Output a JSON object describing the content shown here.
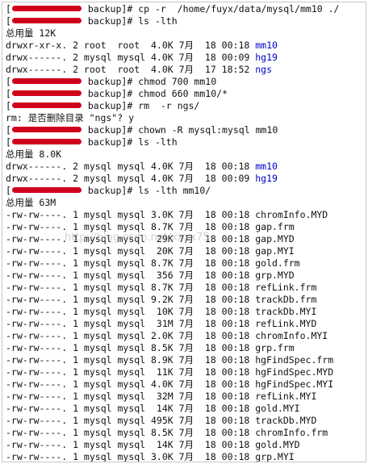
{
  "colors": {
    "directory_name": "#0000cc",
    "redaction": "#d0021b",
    "text": "#111111",
    "background": "#ffffff"
  },
  "watermark": "http://blog.csdn.net/xxxx75",
  "lines": [
    {
      "type": "prompt",
      "cwd": "backup",
      "cmd": "cp -r  /home/fuyx/data/mysql/mm10 ./"
    },
    {
      "type": "prompt",
      "cwd": "backup",
      "cmd": "ls -lth"
    },
    {
      "type": "text",
      "text": "总用量 12K"
    },
    {
      "type": "entry",
      "perm": "drwxr-xr-x.",
      "links": "2",
      "user": "root ",
      "group": "root ",
      "size": "4.0K",
      "month": "7月",
      "day": "18",
      "time": "00:18",
      "name": "mm10",
      "dir": true
    },
    {
      "type": "entry",
      "perm": "drwx------.",
      "links": "2",
      "user": "mysql",
      "group": "mysql",
      "size": "4.0K",
      "month": "7月",
      "day": "18",
      "time": "00:09",
      "name": "hg19",
      "dir": true
    },
    {
      "type": "entry",
      "perm": "drwx------.",
      "links": "2",
      "user": "root ",
      "group": "root ",
      "size": "4.0K",
      "month": "7月",
      "day": "17",
      "time": "18:52",
      "name": "ngs",
      "dir": true
    },
    {
      "type": "prompt",
      "cwd": "backup",
      "cmd": "chmod 700 mm10"
    },
    {
      "type": "prompt",
      "cwd": "backup",
      "cmd": "chmod 660 mm10/*"
    },
    {
      "type": "prompt",
      "cwd": "backup",
      "cmd": "rm  -r ngs/"
    },
    {
      "type": "text",
      "text": "rm: 是否删除目录 \"ngs\"? y"
    },
    {
      "type": "prompt",
      "cwd": "backup",
      "cmd": "chown -R mysql:mysql mm10"
    },
    {
      "type": "prompt",
      "cwd": "backup",
      "cmd": "ls -lth"
    },
    {
      "type": "text",
      "text": "总用量 8.0K"
    },
    {
      "type": "entry",
      "perm": "drwx------.",
      "links": "2",
      "user": "mysql",
      "group": "mysql",
      "size": "4.0K",
      "month": "7月",
      "day": "18",
      "time": "00:18",
      "name": "mm10",
      "dir": true
    },
    {
      "type": "entry",
      "perm": "drwx------.",
      "links": "2",
      "user": "mysql",
      "group": "mysql",
      "size": "4.0K",
      "month": "7月",
      "day": "18",
      "time": "00:09",
      "name": "hg19",
      "dir": true
    },
    {
      "type": "prompt",
      "cwd": "backup",
      "cmd": "ls -lth mm10/"
    },
    {
      "type": "text",
      "text": "总用量 63M"
    },
    {
      "type": "entry",
      "perm": "-rw-rw----.",
      "links": "1",
      "user": "mysql",
      "group": "mysql",
      "size": "3.0K",
      "month": "7月",
      "day": "18",
      "time": "00:18",
      "name": "chromInfo.MYD"
    },
    {
      "type": "entry",
      "perm": "-rw-rw----.",
      "links": "1",
      "user": "mysql",
      "group": "mysql",
      "size": "8.7K",
      "month": "7月",
      "day": "18",
      "time": "00:18",
      "name": "gap.frm"
    },
    {
      "type": "entry",
      "perm": "-rw-rw----.",
      "links": "1",
      "user": "mysql",
      "group": "mysql",
      "size": "29K",
      "month": "7月",
      "day": "18",
      "time": "00:18",
      "name": "gap.MYD"
    },
    {
      "type": "entry",
      "perm": "-rw-rw----.",
      "links": "1",
      "user": "mysql",
      "group": "mysql",
      "size": "20K",
      "month": "7月",
      "day": "18",
      "time": "00:18",
      "name": "gap.MYI"
    },
    {
      "type": "entry",
      "perm": "-rw-rw----.",
      "links": "1",
      "user": "mysql",
      "group": "mysql",
      "size": "8.7K",
      "month": "7月",
      "day": "18",
      "time": "00:18",
      "name": "gold.frm"
    },
    {
      "type": "entry",
      "perm": "-rw-rw----.",
      "links": "1",
      "user": "mysql",
      "group": "mysql",
      "size": "356",
      "month": "7月",
      "day": "18",
      "time": "00:18",
      "name": "grp.MYD"
    },
    {
      "type": "entry",
      "perm": "-rw-rw----.",
      "links": "1",
      "user": "mysql",
      "group": "mysql",
      "size": "8.7K",
      "month": "7月",
      "day": "18",
      "time": "00:18",
      "name": "refLink.frm"
    },
    {
      "type": "entry",
      "perm": "-rw-rw----.",
      "links": "1",
      "user": "mysql",
      "group": "mysql",
      "size": "9.2K",
      "month": "7月",
      "day": "18",
      "time": "00:18",
      "name": "trackDb.frm"
    },
    {
      "type": "entry",
      "perm": "-rw-rw----.",
      "links": "1",
      "user": "mysql",
      "group": "mysql",
      "size": "10K",
      "month": "7月",
      "day": "18",
      "time": "00:18",
      "name": "trackDb.MYI"
    },
    {
      "type": "entry",
      "perm": "-rw-rw----.",
      "links": "1",
      "user": "mysql",
      "group": "mysql",
      "size": "31M",
      "month": "7月",
      "day": "18",
      "time": "00:18",
      "name": "refLink.MYD"
    },
    {
      "type": "entry",
      "perm": "-rw-rw----.",
      "links": "1",
      "user": "mysql",
      "group": "mysql",
      "size": "2.0K",
      "month": "7月",
      "day": "18",
      "time": "00:18",
      "name": "chromInfo.MYI"
    },
    {
      "type": "entry",
      "perm": "-rw-rw----.",
      "links": "1",
      "user": "mysql",
      "group": "mysql",
      "size": "8.5K",
      "month": "7月",
      "day": "18",
      "time": "00:18",
      "name": "grp.frm"
    },
    {
      "type": "entry",
      "perm": "-rw-rw----.",
      "links": "1",
      "user": "mysql",
      "group": "mysql",
      "size": "8.9K",
      "month": "7月",
      "day": "18",
      "time": "00:18",
      "name": "hgFindSpec.frm"
    },
    {
      "type": "entry",
      "perm": "-rw-rw----.",
      "links": "1",
      "user": "mysql",
      "group": "mysql",
      "size": "11K",
      "month": "7月",
      "day": "18",
      "time": "00:18",
      "name": "hgFindSpec.MYD"
    },
    {
      "type": "entry",
      "perm": "-rw-rw----.",
      "links": "1",
      "user": "mysql",
      "group": "mysql",
      "size": "4.0K",
      "month": "7月",
      "day": "18",
      "time": "00:18",
      "name": "hgFindSpec.MYI"
    },
    {
      "type": "entry",
      "perm": "-rw-rw----.",
      "links": "1",
      "user": "mysql",
      "group": "mysql",
      "size": "32M",
      "month": "7月",
      "day": "18",
      "time": "00:18",
      "name": "refLink.MYI"
    },
    {
      "type": "entry",
      "perm": "-rw-rw----.",
      "links": "1",
      "user": "mysql",
      "group": "mysql",
      "size": "14K",
      "month": "7月",
      "day": "18",
      "time": "00:18",
      "name": "gold.MYI"
    },
    {
      "type": "entry",
      "perm": "-rw-rw----.",
      "links": "1",
      "user": "mysql",
      "group": "mysql",
      "size": "495K",
      "month": "7月",
      "day": "18",
      "time": "00:18",
      "name": "trackDb.MYD"
    },
    {
      "type": "entry",
      "perm": "-rw-rw----.",
      "links": "1",
      "user": "mysql",
      "group": "mysql",
      "size": "8.5K",
      "month": "7月",
      "day": "18",
      "time": "00:18",
      "name": "chromInfo.frm"
    },
    {
      "type": "entry",
      "perm": "-rw-rw----.",
      "links": "1",
      "user": "mysql",
      "group": "mysql",
      "size": "14K",
      "month": "7月",
      "day": "18",
      "time": "00:18",
      "name": "gold.MYD"
    },
    {
      "type": "entry",
      "perm": "-rw-rw----.",
      "links": "1",
      "user": "mysql",
      "group": "mysql",
      "size": "3.0K",
      "month": "7月",
      "day": "18",
      "time": "00:18",
      "name": "grp.MYI"
    }
  ]
}
